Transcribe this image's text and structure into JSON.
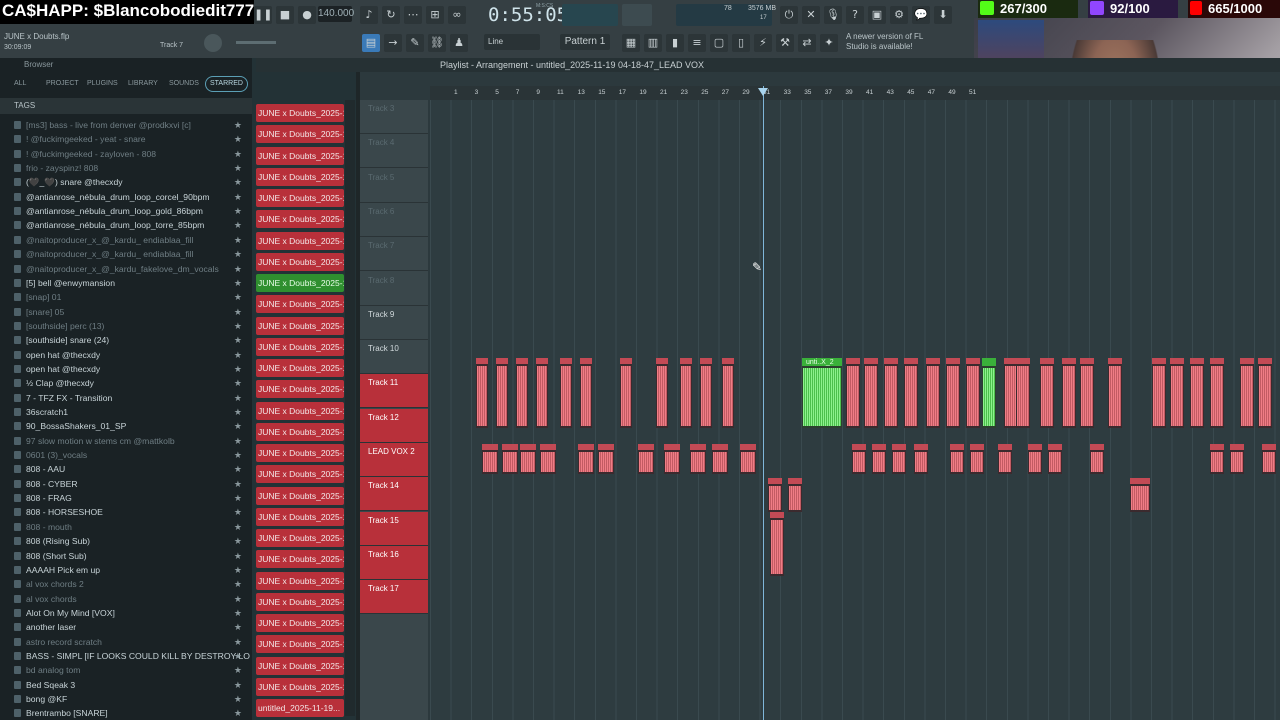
{
  "overlay": {
    "cashapp_text": "CA$HAPP: $Blancobodiedit777",
    "stat1": "267/300",
    "stat2": "92/100",
    "stat3": "665/1000"
  },
  "transport": {
    "song_name": "JUNE x Doubts.flp",
    "song_time": "30:09:09",
    "track_label": "Track 7",
    "tempo": "140.000",
    "time_display": "0:55:05",
    "time_unit": "M:S:CS",
    "cpu_value": "78",
    "mem_value": "3576 MB",
    "mem_sub": "17",
    "pattern": "Pattern 1",
    "snap": "Line",
    "new_version": "A newer version of FL Studio is available!"
  },
  "browser": {
    "title": "Browser",
    "tabs": [
      "ALL",
      "PROJECT",
      "PLUGINS",
      "LIBRARY",
      "SOUNDS",
      "STARRED"
    ],
    "tags_label": "TAGS",
    "items": [
      {
        "label": "[ms3] bass - live from denver @prodkxvi [c]",
        "dim": true
      },
      {
        "label": "! @fuckimgeeked - yeat - snare",
        "dim": true
      },
      {
        "label": "! @fuckimgeeked - zayloven - 808",
        "dim": true
      },
      {
        "label": "frio - zayspinz! 808",
        "dim": true
      },
      {
        "label": "(🖤_🖤) snare @thecxdy",
        "dim": false
      },
      {
        "label": "@antianrose_nébula_drum_loop_corcel_90bpm",
        "dim": false
      },
      {
        "label": "@antianrose_nébula_drum_loop_gold_86bpm",
        "dim": false
      },
      {
        "label": "@antianrose_nébula_drum_loop_torre_85bpm",
        "dim": false
      },
      {
        "label": "@naitoproducer_x_@_kardu_ endiablaa_fill",
        "dim": true
      },
      {
        "label": "@naitoproducer_x_@_kardu_ endiablaa_fill",
        "dim": true
      },
      {
        "label": "@naitoproducer_x_@_kardu_fakelove_dm_vocals",
        "dim": true
      },
      {
        "label": "[5] bell @enwymansion",
        "dim": false
      },
      {
        "label": "[snap] 01",
        "dim": true
      },
      {
        "label": "[snare] 05",
        "dim": true
      },
      {
        "label": "[southside] perc (13)",
        "dim": true
      },
      {
        "label": "[southside] snare (24)",
        "dim": false
      },
      {
        "label": "open hat @thecxdy",
        "dim": false
      },
      {
        "label": "open hat @thecxdy",
        "dim": false
      },
      {
        "label": "½ Clap @thecxdy",
        "dim": false
      },
      {
        "label": "7 - TFZ FX - Transition",
        "dim": false
      },
      {
        "label": "36scratch1",
        "dim": false
      },
      {
        "label": "90_BossaShakers_01_SP",
        "dim": false
      },
      {
        "label": "97 slow motion w stems cm @mattkolb",
        "dim": true
      },
      {
        "label": "0601 (3)_vocals",
        "dim": true
      },
      {
        "label": "808 - AAU",
        "dim": false
      },
      {
        "label": "808 - CYBER",
        "dim": false
      },
      {
        "label": "808 - FRAG",
        "dim": false
      },
      {
        "label": "808 - HORSESHOE",
        "dim": false
      },
      {
        "label": "808 - mouth",
        "dim": true
      },
      {
        "label": "808 (Rising Sub)",
        "dim": false
      },
      {
        "label": "808 (Short Sub)",
        "dim": false
      },
      {
        "label": "AAAAH Pick em up",
        "dim": false
      },
      {
        "label": "al vox chords 2",
        "dim": true
      },
      {
        "label": "al vox chords",
        "dim": true
      },
      {
        "label": "Alot On My Mind [VOX]",
        "dim": false
      },
      {
        "label": "another laser",
        "dim": false
      },
      {
        "label": "astro record scratch",
        "dim": true
      },
      {
        "label": "BASS - SIMPL [IF LOOKS COULD KILL BY DESTROY LONELY]",
        "dim": false
      },
      {
        "label": "bd analog tom",
        "dim": true
      },
      {
        "label": "Bed Sqeak 3",
        "dim": false
      },
      {
        "label": "bong @KF",
        "dim": false
      },
      {
        "label": "Brentrambo [SNARE]",
        "dim": false
      }
    ]
  },
  "channels": {
    "items": [
      "JUNE x Doubts_2025-11-...",
      "JUNE x Doubts_2025-11-...",
      "JUNE x Doubts_2025-11-...",
      "JUNE x Doubts_2025-11-...",
      "JUNE x Doubts_2025-11-...",
      "JUNE x Doubts_2025-11-...",
      "JUNE x Doubts_2025-11-...",
      "JUNE x Doubts_2025-11-...",
      "JUNE x Doubts_2025-11-...",
      "JUNE x Doubts_2025-11-...",
      "JUNE x Doubts_2025-11-...",
      "JUNE x Doubts_2025-11-...",
      "JUNE x Doubts_2025-11-...",
      "JUNE x Doubts_2025-11-...",
      "JUNE x Doubts_2025-11-...",
      "JUNE x Doubts_2025-11-...",
      "JUNE x Doubts_2025-11-...",
      "JUNE x Doubts_2025-11-...",
      "JUNE x Doubts_2025-11-...",
      "JUNE x Doubts_2025-11-...",
      "JUNE x Doubts_2025-11-...",
      "JUNE x Doubts_2025-11-...",
      "JUNE x Doubts_2025-11-...",
      "JUNE x Doubts_2025-11-...",
      "JUNE x Doubts_2025-11-...",
      "JUNE x Doubts_2025-11-...",
      "JUNE x Doubts_2025-11-...",
      "JUNE x Doubts_2025-11-..."
    ],
    "selected_index": 8,
    "last": "untitled_2025-11-19..."
  },
  "playlist": {
    "title": "Playlist - Arrangement",
    "filename": "untitled_2025-11-19 04-18-47_LEAD VOX",
    "ruler": [
      "1",
      "3",
      "5",
      "7",
      "9",
      "11",
      "13",
      "15",
      "17",
      "19",
      "21",
      "23",
      "25",
      "27",
      "29",
      "31",
      "33",
      "35",
      "37",
      "39",
      "41",
      "43",
      "45",
      "47",
      "49",
      "51"
    ],
    "tracks": [
      {
        "label": "Track 3",
        "state": "empty"
      },
      {
        "label": "Track 4",
        "state": "empty"
      },
      {
        "label": "Track 5",
        "state": "empty"
      },
      {
        "label": "Track 6",
        "state": "empty"
      },
      {
        "label": "Track 7",
        "state": "empty"
      },
      {
        "label": "Track 8",
        "state": "empty"
      },
      {
        "label": "Track 9",
        "state": "named"
      },
      {
        "label": "Track 10",
        "state": "named"
      },
      {
        "label": "Track 11",
        "state": "active"
      },
      {
        "label": "Track 12",
        "state": "active"
      },
      {
        "label": "LEAD VOX 2",
        "state": "active"
      },
      {
        "label": "Track 14",
        "state": "active"
      },
      {
        "label": "Track 15",
        "state": "active"
      },
      {
        "label": "Track 16",
        "state": "active"
      },
      {
        "label": "Track 17",
        "state": "active"
      }
    ],
    "green_clip_label": "unti..X_2"
  },
  "colors": {
    "clip_red": "#c34a55",
    "clip_green": "#3ab03a",
    "track_active": "#b8303a",
    "playhead": "#7fb6d9"
  }
}
